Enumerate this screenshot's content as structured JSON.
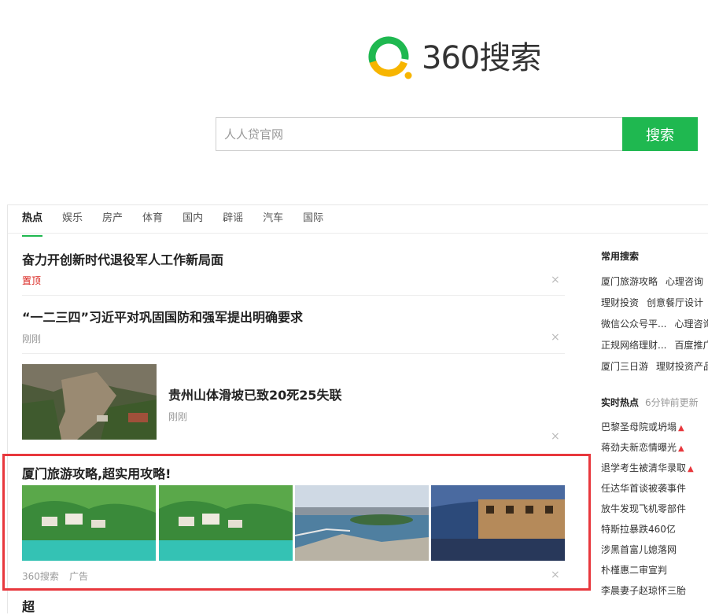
{
  "logo": {
    "text": "360搜索",
    "colors": {
      "green": "#1fb850",
      "yellow": "#f7b500"
    }
  },
  "search": {
    "placeholder": "人人贷官网",
    "button_label": "搜索"
  },
  "tabs": [
    {
      "label": "热点",
      "active": true
    },
    {
      "label": "娱乐"
    },
    {
      "label": "房产"
    },
    {
      "label": "体育"
    },
    {
      "label": "国内"
    },
    {
      "label": "辟谣"
    },
    {
      "label": "汽车"
    },
    {
      "label": "国际"
    }
  ],
  "news": [
    {
      "title": "奋力开创新时代退役军人工作新局面",
      "meta": "置顶"
    },
    {
      "title": "“一二三四”习近平对巩固国防和强军提出明确要求",
      "meta": "刚刚"
    },
    {
      "title": "贵州山体滑坡已致20死25失联",
      "meta": "刚刚"
    }
  ],
  "ad": {
    "title": "厦门旅游攻略,超实用攻略!",
    "source": "360搜索",
    "tag": "广告"
  },
  "close_glyph": "×",
  "common_search": {
    "heading": "常用搜索",
    "rows": [
      [
        "厦门旅游攻略",
        "心理咨询"
      ],
      [
        "理财投资",
        "创意餐厅设计"
      ],
      [
        "微信公众号平...",
        "心理咨询"
      ],
      [
        "正规网络理财...",
        "百度推广"
      ],
      [
        "厦门三日游",
        "理财投资产品"
      ]
    ]
  },
  "realtime_hot": {
    "heading": "实时热点",
    "updated": "6分钟前更新",
    "items": [
      {
        "text": "巴黎圣母院或坍塌",
        "hot": true
      },
      {
        "text": "蒋劲夫新恋情曝光",
        "hot": true
      },
      {
        "text": "退学考生被清华录取",
        "hot": true
      },
      {
        "text": "任达华首谈被袭事件",
        "hot": false
      },
      {
        "text": "放牛发现飞机零部件",
        "hot": false
      },
      {
        "text": "特斯拉暴跌460亿",
        "hot": false
      },
      {
        "text": "涉黑首富儿媳落网",
        "hot": false
      },
      {
        "text": "朴槿惠二审宣判",
        "hot": false
      },
      {
        "text": "李晨妻子赵琼怀三胎",
        "hot": false
      }
    ]
  },
  "bottom_partial": {
    "text": "超"
  }
}
